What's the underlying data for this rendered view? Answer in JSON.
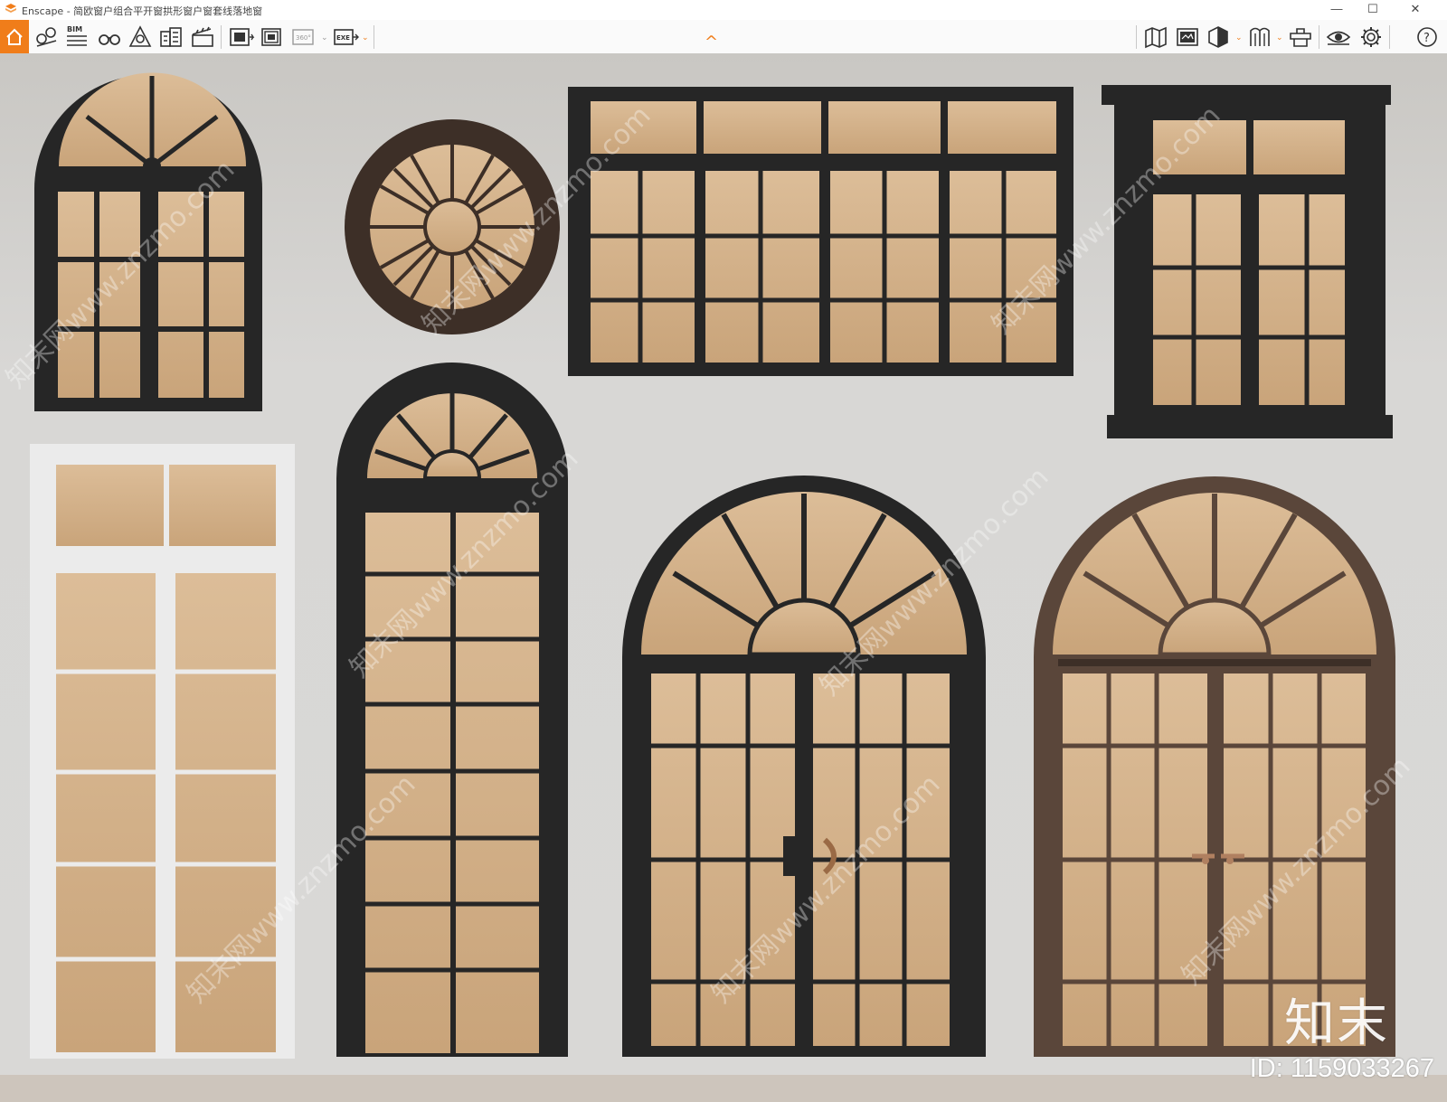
{
  "window": {
    "app_name": "Enscape",
    "title": "Enscape - 简欧窗户组合平开窗拱形窗户窗套线落地窗",
    "minimize_glyph": "—",
    "maximize_glyph": "☐",
    "close_glyph": "✕"
  },
  "toolbar": {
    "left_icons": [
      "home-icon",
      "asset-library-icon",
      "bim-icon",
      "binoculars-icon",
      "views-icon",
      "building-icon",
      "clapper-icon",
      "screenshot-icon",
      "batch-render-icon",
      "panorama-360-icon",
      "exe-export-icon"
    ],
    "bim_label": "BIM",
    "pano_label": "360°",
    "exe_label": "EXE",
    "collapse_glyph": "^",
    "right_icons": [
      "map-icon",
      "render-settings-icon",
      "view-cube-icon",
      "materials-icon",
      "manage-uploads-icon",
      "visual-settings-icon",
      "settings-gear-icon",
      "help-icon"
    ],
    "help_glyph": "?"
  },
  "scene": {
    "watermark_text": "知末网www.znzmo.com",
    "brand_text": "知末",
    "id_text": "ID: 1159033267",
    "colors": {
      "wall": "#d6d5d3",
      "glass": "#d8b48c",
      "frame_black": "#262626",
      "frame_brown": "#3c2e26",
      "frame_white": "#e8e8e8",
      "floor": "#cdc5bc",
      "accent": "#f07d1a"
    }
  }
}
